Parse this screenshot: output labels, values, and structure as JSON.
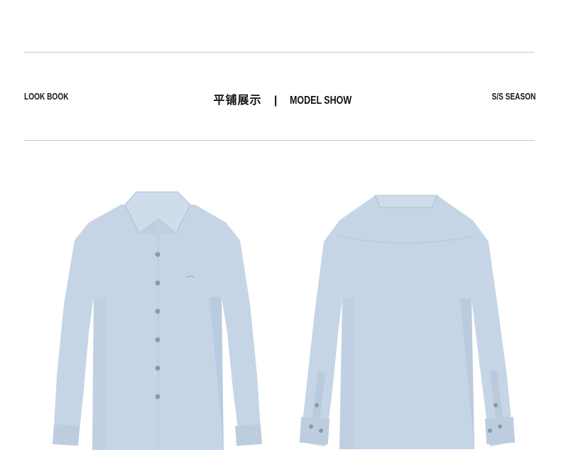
{
  "header": {
    "left": "LOOK BOOK",
    "center_cn": "平铺展示",
    "separator": "|",
    "center_en": "MODEL SHOW",
    "right": "S/S SEASON"
  },
  "images": [
    {
      "alt": "shirt-front"
    },
    {
      "alt": "shirt-back"
    }
  ],
  "colors": {
    "shirt": "#c6d5e6",
    "shirt_shadow": "#b3c4d8",
    "button": "#8f98a3",
    "rule": "#c9c9c9"
  }
}
